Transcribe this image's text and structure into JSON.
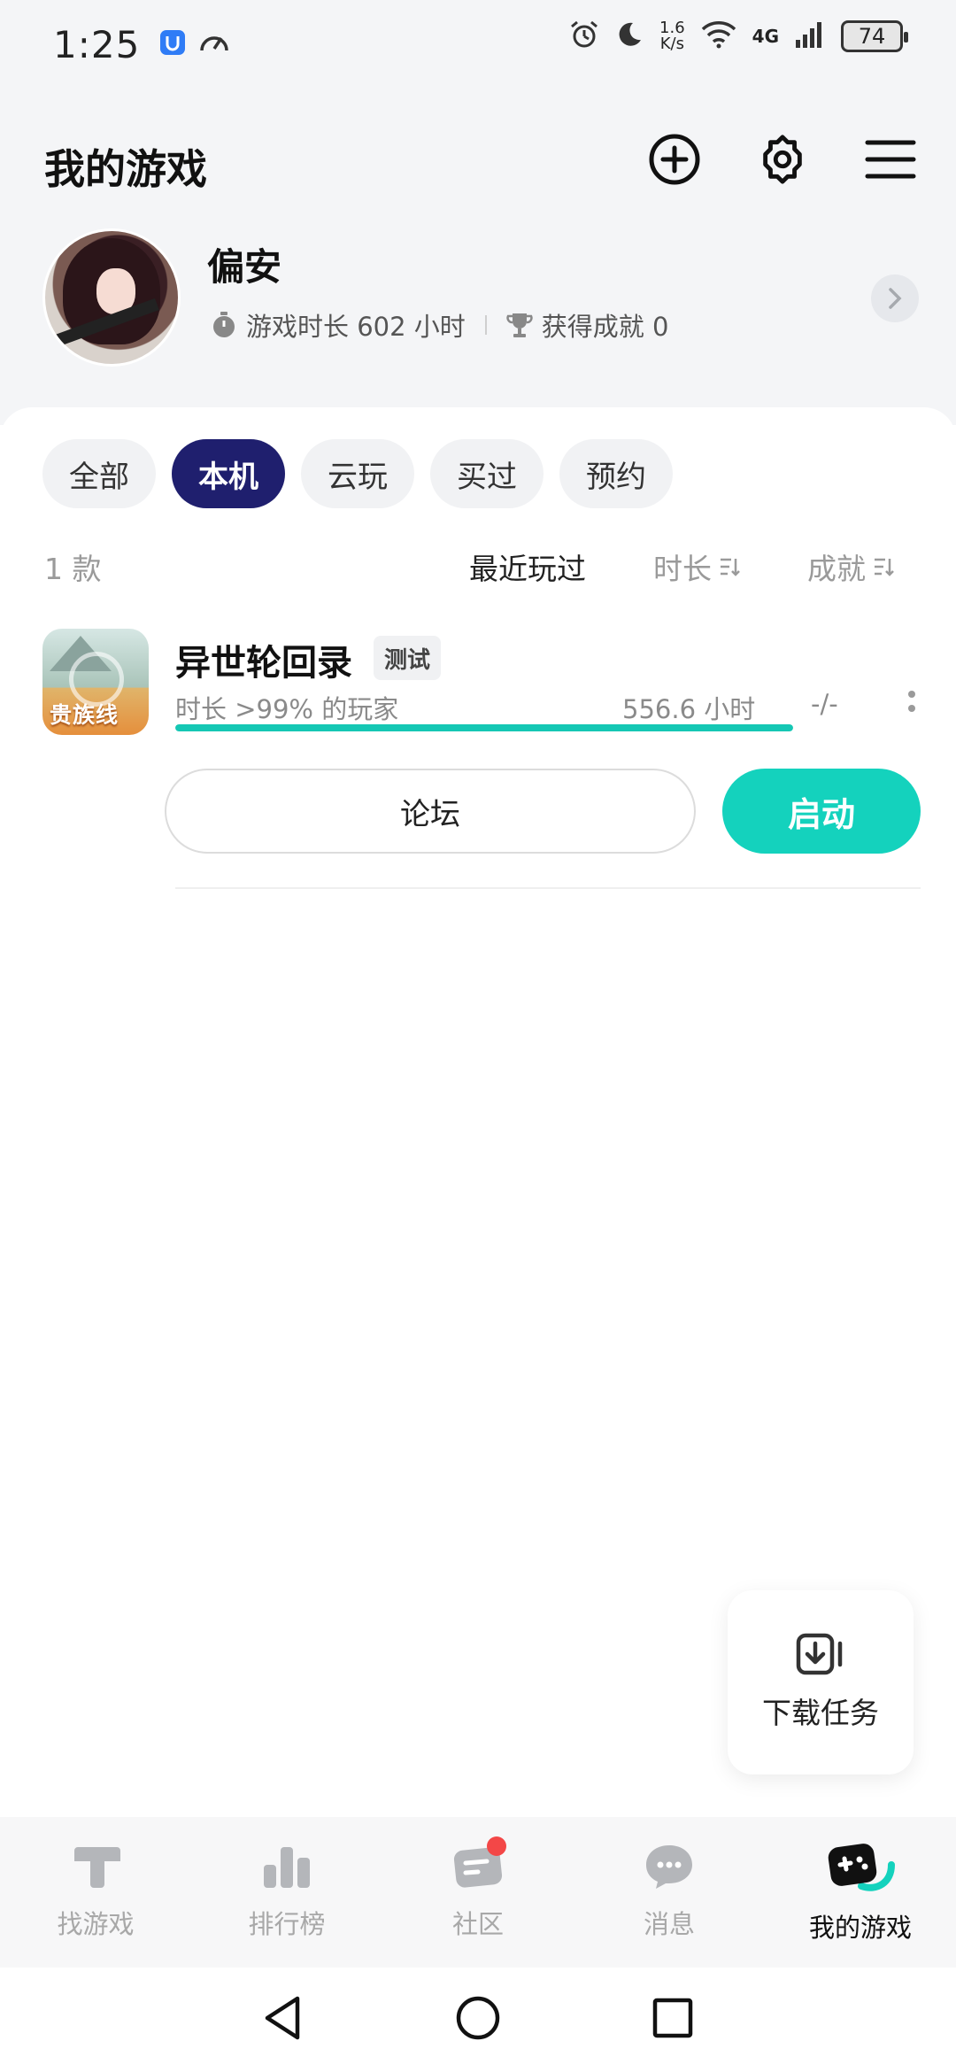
{
  "status_bar": {
    "time": "1:25",
    "speed_top": "1.6",
    "speed_bottom": "K/s",
    "network": "4G",
    "battery": "74"
  },
  "header": {
    "title": "我的游戏"
  },
  "profile": {
    "name": "偏安",
    "playtime": "游戏时长 602 小时",
    "achievements": "获得成就 0"
  },
  "filters": [
    "全部",
    "本机",
    "云玩",
    "买过",
    "预约"
  ],
  "sort": {
    "count": "1 款",
    "recent": "最近玩过",
    "duration": "时长",
    "achievement": "成就"
  },
  "game": {
    "title": "异世轮回录",
    "tag": "测试",
    "icon_text": "贵族线",
    "rank_text": "时长 >99% 的玩家",
    "hours": "556.6 小时",
    "achievements": "-/-",
    "progress": 1.0,
    "forum_label": "论坛",
    "launch_label": "启动"
  },
  "download": {
    "label": "下载任务"
  },
  "nav": {
    "items": [
      {
        "label": "找游戏"
      },
      {
        "label": "排行榜"
      },
      {
        "label": "社区"
      },
      {
        "label": "消息"
      },
      {
        "label": "我的游戏"
      }
    ]
  },
  "colors": {
    "accent": "#14d2bd",
    "chip_active": "#1f1f6e",
    "badge": "#f34747"
  }
}
